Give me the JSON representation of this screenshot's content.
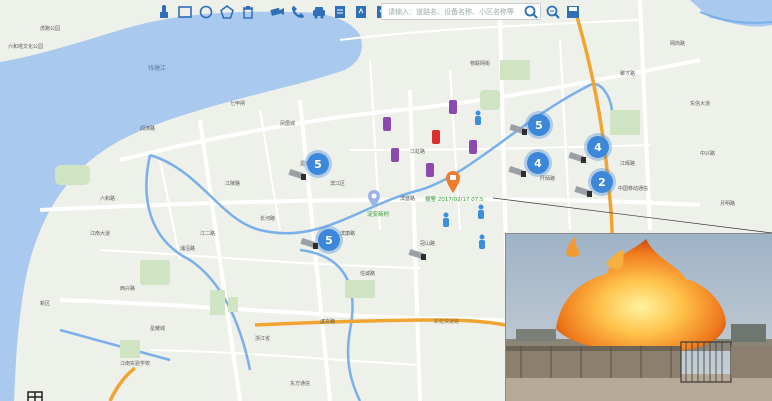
{
  "toolbar": {
    "tools": [
      "pan-icon",
      "rectangle-icon",
      "circle-icon",
      "polygon-icon",
      "trash-icon",
      "camera-icon",
      "phone-icon",
      "car-icon",
      "report-icon",
      "export-icon",
      "import-icon",
      "document-icon"
    ],
    "search_placeholder": "请输入：道路名、设备名称、小区名称等",
    "search_icon": "search-icon",
    "zoom_search_icon": "magnify-icon",
    "save_icon": "save-icon"
  },
  "clusters": [
    "5",
    "5",
    "5",
    "4",
    "4",
    "2"
  ],
  "alarm": {
    "text": "报警 2017/02/17 07:5"
  },
  "location_label": "淀安新村",
  "river_label": "钱塘江",
  "map_labels": [
    "六和塔文化公园",
    "钱塘江",
    "虎跑公园",
    "七甲闸",
    "凤凰城",
    "星光大道",
    "江陵路",
    "滨江区",
    "闻涛路",
    "江南大道",
    "长河路",
    "西兴路",
    "浦沿路",
    "江二路",
    "中国移动通信",
    "新区",
    "江南实验学校",
    "浙江省",
    "信诚路",
    "冠山路",
    "滨文路",
    "彩虹快速路",
    "物联网街",
    "东信大道",
    "中兴路",
    "聚才路",
    "网商路",
    "月明路",
    "星耀城",
    "东方通信",
    "六和路",
    "江虹路",
    "阡陌路",
    "江晖路",
    "滨盛路",
    "滨康路"
  ],
  "colors": {
    "water": "#a9c9ee",
    "land": "#eef0ea",
    "road_major": "#f0a533",
    "road_blue": "#7ab0ea",
    "cluster": "#3d87da",
    "phone_purple": "#8c4ab0",
    "phone_red": "#d93030",
    "person_blue": "#3c8ede",
    "alarm_orange": "#f07a2e"
  }
}
